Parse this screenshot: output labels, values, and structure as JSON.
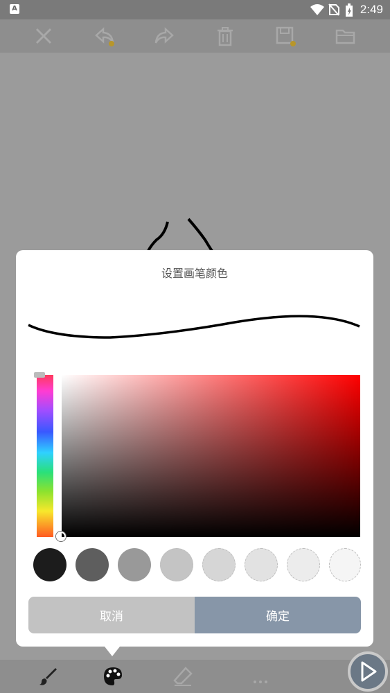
{
  "status_bar": {
    "time": "2:49",
    "notification_glyph": "A",
    "icons": [
      "wifi-icon",
      "no-sim-icon",
      "battery-icon"
    ]
  },
  "toolbar": {
    "icons": [
      "close-icon",
      "undo-icon",
      "redo-icon",
      "trash-icon",
      "save-icon",
      "folder-icon"
    ]
  },
  "dialog": {
    "title": "设置画笔颜色",
    "cancel_label": "取消",
    "confirm_label": "确定",
    "swatches": [
      "#1c1c1c",
      "#5e5e5e",
      "#999999",
      "#c4c4c4",
      "#d6d6d6",
      "#e2e2e2",
      "#ececec",
      "#f5f5f5"
    ]
  },
  "bottom_bar": {
    "icons": [
      "brush-icon",
      "palette-icon",
      "eraser-icon",
      "more-icon"
    ]
  },
  "fab": {
    "icon": "play-icon"
  }
}
